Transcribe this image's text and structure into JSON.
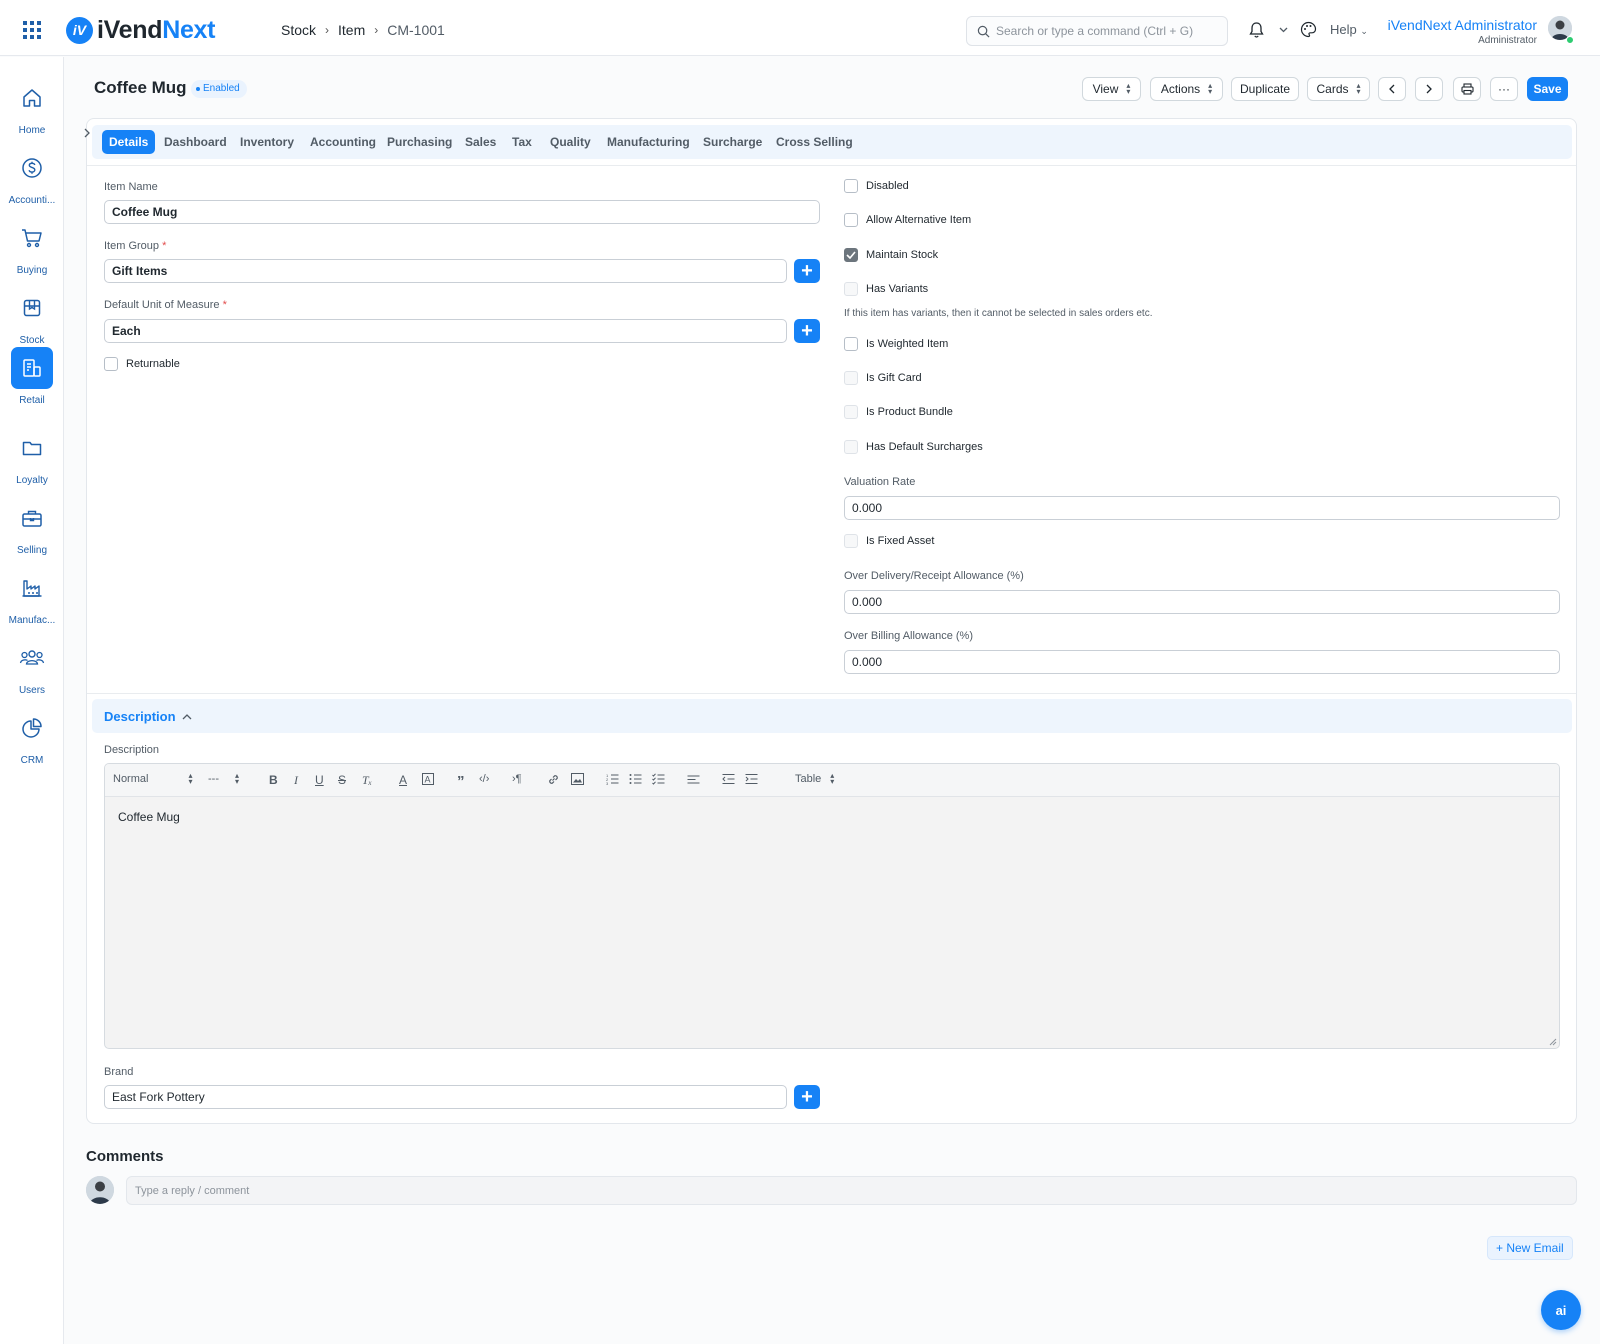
{
  "app": {
    "logo_prefix": "iVend",
    "logo_suffix": "Next",
    "logo_mark": "iV"
  },
  "breadcrumb": [
    "Stock",
    "Item",
    "CM-1001"
  ],
  "search": {
    "placeholder": "Search or type a command (Ctrl + G)"
  },
  "topbar": {
    "help_label": "Help",
    "user_name": "iVendNext Administrator",
    "user_role": "Administrator"
  },
  "sidebar": {
    "items": [
      {
        "label": "Home",
        "icon": "home-icon"
      },
      {
        "label": "Accounti...",
        "icon": "dollar-icon"
      },
      {
        "label": "Buying",
        "icon": "cart-icon"
      },
      {
        "label": "Stock",
        "icon": "box-icon"
      },
      {
        "label": "Retail",
        "icon": "retail-icon",
        "active": true
      },
      {
        "label": "Loyalty",
        "icon": "folder-icon"
      },
      {
        "label": "Selling",
        "icon": "briefcase-icon"
      },
      {
        "label": "Manufac...",
        "icon": "factory-icon"
      },
      {
        "label": "Users",
        "icon": "users-icon"
      },
      {
        "label": "CRM",
        "icon": "pie-chart-icon"
      }
    ]
  },
  "page": {
    "title": "Coffee Mug",
    "status": "Enabled"
  },
  "actions": {
    "view": "View",
    "actions": "Actions",
    "duplicate": "Duplicate",
    "cards": "Cards",
    "more": "···",
    "save": "Save"
  },
  "tabs": [
    "Details",
    "Dashboard",
    "Inventory",
    "Accounting",
    "Purchasing",
    "Sales",
    "Tax",
    "Quality",
    "Manufacturing",
    "Surcharge",
    "Cross Selling"
  ],
  "form": {
    "item_name_label": "Item Name",
    "item_name": "Coffee Mug",
    "item_group_label": "Item Group",
    "item_group": "Gift Items",
    "uom_label": "Default Unit of Measure",
    "uom": "Each",
    "returnable_label": "Returnable",
    "checks": {
      "disabled": "Disabled",
      "allow_alternative": "Allow Alternative Item",
      "maintain_stock": "Maintain Stock",
      "has_variants": "Has Variants",
      "variants_help": "If this item has variants, then it cannot be selected in sales orders etc.",
      "is_weighted": "Is Weighted Item",
      "is_gift_card": "Is Gift Card",
      "is_product_bundle": "Is Product Bundle",
      "has_default_surcharges": "Has Default Surcharges",
      "is_fixed_asset": "Is Fixed Asset"
    },
    "valuation_rate_label": "Valuation Rate",
    "valuation_rate": "0.000",
    "over_delivery_label": "Over Delivery/Receipt Allowance (%)",
    "over_delivery": "0.000",
    "over_billing_label": "Over Billing Allowance (%)",
    "over_billing": "0.000"
  },
  "description_section": {
    "title": "Description",
    "field_label": "Description",
    "toolbar": {
      "style_select": "Normal",
      "font_select": "---",
      "table_select": "Table"
    },
    "content": "Coffee Mug"
  },
  "brand": {
    "label": "Brand",
    "value": "East Fork Pottery"
  },
  "comments": {
    "title": "Comments",
    "placeholder": "Type a reply / comment"
  },
  "new_email": "+ New Email",
  "ai_button": "ai",
  "colors": {
    "accent": "#1682f6",
    "nav": "#1f5fa8"
  }
}
